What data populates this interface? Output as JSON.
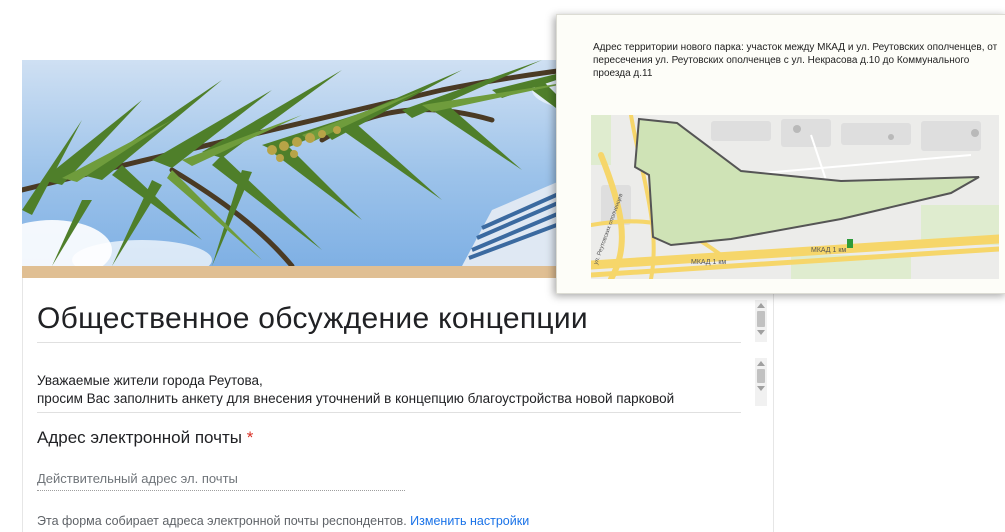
{
  "form": {
    "title": "Общественное обсуждение концепции",
    "description_line1": "Уважаемые жители города Реутова,",
    "description_line2": "просим Вас заполнить анкету для внесения уточнений в концепцию благоустройства новой парковой",
    "email_label": "Адрес электронной почты",
    "required_mark": "*",
    "email_placeholder": "Действительный адрес эл. почты",
    "collect_note": "Эта форма собирает адреса электронной почты респондентов.",
    "change_settings_link": "Изменить настройки"
  },
  "map_card": {
    "caption": "Адрес территории нового парка: участок между МКАД и ул. Реутовских ополченцев, от пересечения ул. Реутовских ополченцев с ул. Некрасова д.10 до Коммунального проезда д.11",
    "road_label_1": "МКАД 1 км",
    "road_label_2": "МКАД 1 км",
    "street_label": "ул. Реутовских ополченцев"
  },
  "colors": {
    "banner_stripe": "#e0bf93",
    "park_fill": "#cfe3b6",
    "park_outline": "#555555",
    "road_yellow": "#f6d66a",
    "link": "#1a73e8",
    "required": "#d93025"
  },
  "icons": {
    "title_scroll": "scrollbar",
    "desc_scroll": "scrollbar",
    "map_marker": "green-marker-icon"
  }
}
